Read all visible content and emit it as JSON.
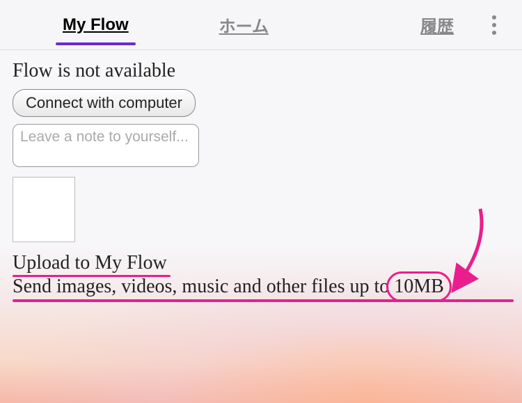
{
  "tabs": {
    "myflow": "My Flow",
    "home": "ホーム",
    "history": "履歴"
  },
  "status": {
    "title": "Flow is not available",
    "connect_label": "Connect with computer",
    "note_placeholder": "Leave a note to yourself..."
  },
  "upload": {
    "title": "Upload to My Flow",
    "desc_prefix": "Send images, videos, music and other files up to ",
    "size": "10MB"
  }
}
